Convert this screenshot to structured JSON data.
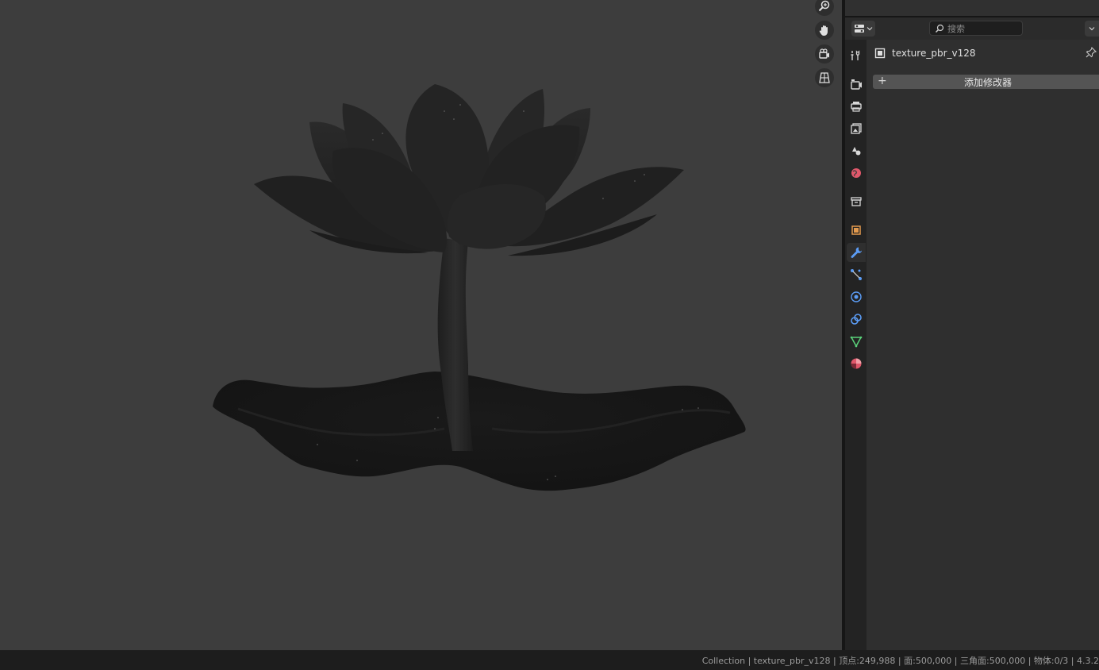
{
  "viewport": {
    "nav_gizmos": [
      "zoom-icon",
      "pan-hand-icon",
      "camera-view-icon",
      "ortho-grid-icon"
    ]
  },
  "properties": {
    "search_placeholder": "搜索",
    "object_name": "texture_pbr_v128",
    "add_modifier_label": "添加修改器",
    "tabs": [
      {
        "name": "tool-tab",
        "icon": "tool-icon"
      },
      {
        "name": "render-tab",
        "icon": "render-icon"
      },
      {
        "name": "output-tab",
        "icon": "output-icon"
      },
      {
        "name": "view-layer-tab",
        "icon": "view-layer-icon"
      },
      {
        "name": "scene-tab",
        "icon": "scene-icon"
      },
      {
        "name": "world-tab",
        "icon": "world-icon"
      },
      {
        "name": "collection-tab",
        "icon": "collection-icon"
      },
      {
        "name": "object-tab",
        "icon": "object-icon"
      },
      {
        "name": "modifiers-tab",
        "icon": "wrench-icon",
        "active": true
      },
      {
        "name": "particles-tab",
        "icon": "particles-icon"
      },
      {
        "name": "physics-tab",
        "icon": "physics-icon"
      },
      {
        "name": "constraints-tab",
        "icon": "constraints-icon"
      },
      {
        "name": "data-tab",
        "icon": "mesh-data-icon"
      },
      {
        "name": "material-tab",
        "icon": "material-icon"
      }
    ]
  },
  "colors": {
    "viewport_bg": "#3d3d3d",
    "active_tab_icon": "#5b9cf5",
    "object_icon": "#e39a4e",
    "world_icon": "#e0586b",
    "data_icon": "#5ad17a"
  },
  "status": {
    "text": "Collection | texture_pbr_v128 | 顶点:249,988 | 面:500,000 | 三角面:500,000 | 物体:0/3 | 4.3.2"
  }
}
